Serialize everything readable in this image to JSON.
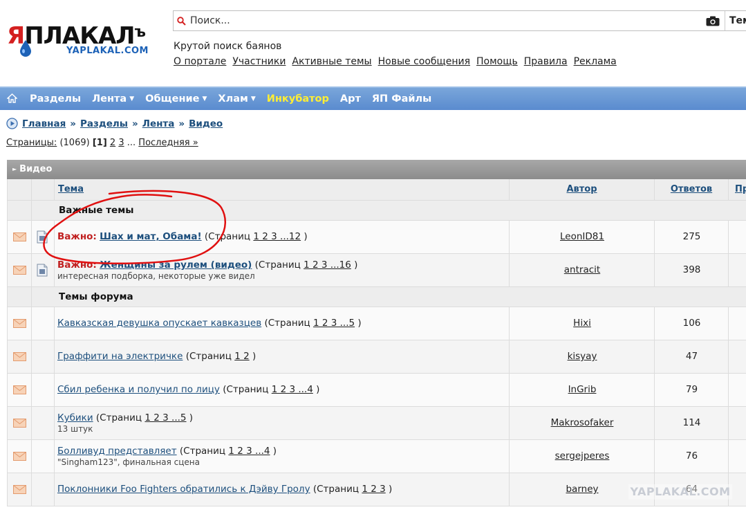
{
  "logo": {
    "main_red": "Я",
    "main": "ПЛАКАЛ",
    "hard": "ъ",
    "sub": "YAPLAKAL.COM"
  },
  "search": {
    "placeholder": "Поиск...",
    "scope": "Темы"
  },
  "tagline": "Крутой поиск баянов",
  "toplinks": [
    "О портале",
    "Участники",
    "Активные темы",
    "Новые сообщения",
    "Помощь",
    "Правила",
    "Реклама"
  ],
  "nav": {
    "items": [
      {
        "label": "Разделы",
        "caret": false,
        "highlight": false
      },
      {
        "label": "Лента",
        "caret": true,
        "highlight": false
      },
      {
        "label": "Общение",
        "caret": true,
        "highlight": false
      },
      {
        "label": "Хлам",
        "caret": true,
        "highlight": false
      },
      {
        "label": "Инкубатор",
        "caret": false,
        "highlight": true
      },
      {
        "label": "Арт",
        "caret": false,
        "highlight": false
      },
      {
        "label": "ЯП Файлы",
        "caret": false,
        "highlight": false
      }
    ]
  },
  "breadcrumbs": [
    "Главная",
    "Разделы",
    "Лента",
    "Видео"
  ],
  "breadcrumb_sep": "»",
  "pagination": {
    "label": "Страницы:",
    "count": "(1069)",
    "current": "[1]",
    "pages": [
      "2",
      "3"
    ],
    "ellipsis": "...",
    "last": "Последняя »"
  },
  "forum": {
    "title": "Видео",
    "columns": {
      "topic": "Тема",
      "author": "Автор",
      "replies": "Ответов",
      "extra": "Пр"
    },
    "important_label": "Важные темы",
    "forum_label": "Темы форума",
    "important_prefix": "Важно:",
    "pages_word": "(Страниц",
    "important": [
      {
        "title": "Шах и мат, Обама!",
        "pages": "1 2 3 ...12",
        "desc": "",
        "author": "LeonID81",
        "replies": "275"
      },
      {
        "title": "Женщины за рулем (видео)",
        "pages": "1 2 3 ...16",
        "desc": "интересная подборка, некоторые уже видел",
        "author": "antracit",
        "replies": "398"
      }
    ],
    "topics": [
      {
        "title": "Кавказская девушка опускает кавказцев",
        "pages": "1 2 3 ...5",
        "desc": "",
        "author": "Hixi",
        "replies": "106"
      },
      {
        "title": "Граффити на электричке",
        "pages": "1 2",
        "desc": "",
        "author": "kisyay",
        "replies": "47"
      },
      {
        "title": "Сбил ребенка и получил по лицу",
        "pages": "1 2 3 ...4",
        "desc": "",
        "author": "InGrib",
        "replies": "79"
      },
      {
        "title": "Кубики",
        "pages": "1 2 3 ...5",
        "desc": "13 штук",
        "author": "Makrosofaker",
        "replies": "114"
      },
      {
        "title": "Болливуд представляет",
        "pages": "1 2 3 ...4",
        "desc": "\"Singham123\", финальная сцена",
        "author": "sergejperes",
        "replies": "76"
      },
      {
        "title": "Поклонники Foo Fighters обратились к Дэйву Гролу",
        "pages": "1 2 3",
        "desc": "",
        "author": "barney",
        "replies": "64"
      }
    ]
  },
  "watermark": "YAPLAKAL.COM",
  "colors": {
    "nav_bg": "#5a8bcf",
    "link": "#1d4f7d",
    "important": "#c02020",
    "highlight": "#ffee33",
    "annotation": "#e01010"
  }
}
